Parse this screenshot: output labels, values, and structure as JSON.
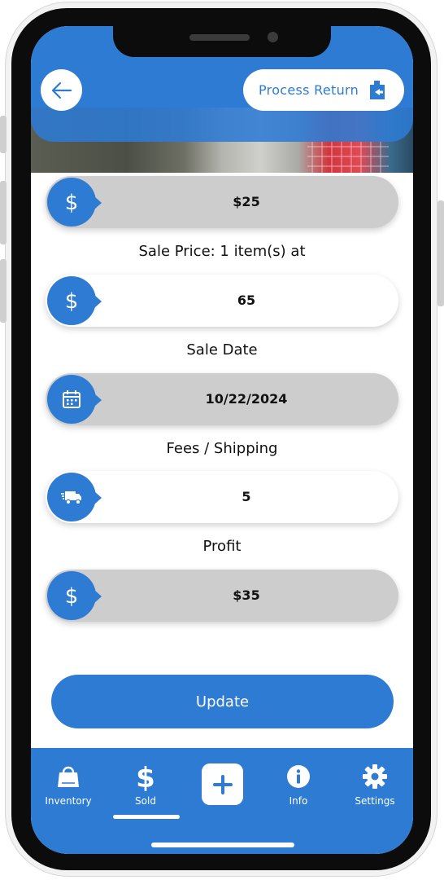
{
  "header": {
    "back_icon": "arrow-left-icon",
    "process_return_label": "Process Return",
    "process_return_icon": "return-box-icon"
  },
  "fields": [
    {
      "label": "",
      "value": "$25",
      "icon": "dollar-icon",
      "style": "gray"
    },
    {
      "label": "Sale Price: 1 item(s) at",
      "value": "65",
      "icon": "dollar-icon",
      "style": "white"
    },
    {
      "label": "Sale Date",
      "value": "10/22/2024",
      "icon": "calendar-icon",
      "style": "gray"
    },
    {
      "label": "Fees / Shipping",
      "value": "5",
      "icon": "truck-icon",
      "style": "white"
    },
    {
      "label": "Profit",
      "value": "$35",
      "icon": "dollar-icon",
      "style": "gray"
    }
  ],
  "update_label": "Update",
  "nav": {
    "items": [
      {
        "label": "Inventory",
        "icon": "shopping-bag-icon"
      },
      {
        "label": "Sold",
        "icon": "dollar-icon",
        "active": true
      },
      {
        "label": "",
        "icon": "plus-icon"
      },
      {
        "label": "Info",
        "icon": "info-icon"
      },
      {
        "label": "Settings",
        "icon": "gear-icon"
      }
    ]
  },
  "colors": {
    "accent": "#2e7bd4",
    "field_gray": "#cdcdcd",
    "text": "#111111"
  }
}
